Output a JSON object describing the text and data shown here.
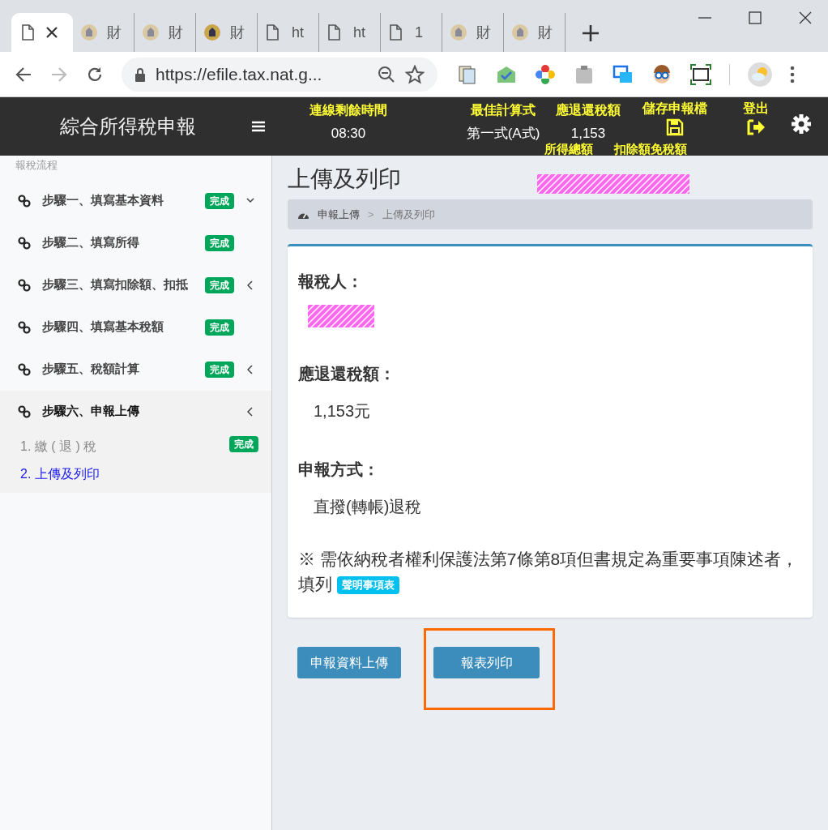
{
  "browser": {
    "tabs": [
      {
        "kind": "page",
        "selected": true
      },
      {
        "kind": "emblem",
        "label": "財",
        "selected": false
      },
      {
        "kind": "emblem",
        "label": "財",
        "selected": false
      },
      {
        "kind": "emblem-dark",
        "label": "財",
        "selected": false
      },
      {
        "kind": "page",
        "label": "ht",
        "selected": false
      },
      {
        "kind": "page",
        "label": "ht",
        "selected": false
      },
      {
        "kind": "page",
        "label": "1",
        "selected": false
      },
      {
        "kind": "emblem",
        "label": "財",
        "selected": false
      },
      {
        "kind": "emblem",
        "label": "財",
        "selected": false
      }
    ],
    "url": "https://efile.tax.nat.g..."
  },
  "header": {
    "title": "綜合所得稅申報",
    "stats": [
      {
        "label": "連線剩餘時間",
        "value": "08:30"
      },
      {
        "label": "最佳計算式",
        "value": "第一式(A式)"
      },
      {
        "label": "應退還稅額",
        "value": "1,153"
      }
    ],
    "actions": [
      {
        "label": "儲存申報檔",
        "kind": "save"
      },
      {
        "label": "登出",
        "kind": "logout"
      }
    ],
    "overflow_labels": [
      "所得總額",
      "扣除額免稅額"
    ]
  },
  "sidebar": {
    "heading": "報稅流程",
    "steps": [
      {
        "label": "步驟一、填寫基本資料",
        "badge": "完成",
        "kind": "down",
        "selected": false
      },
      {
        "label": "步驟二、填寫所得",
        "badge": "完成",
        "kind": "plain",
        "selected": false
      },
      {
        "label": "步驟三、填寫扣除額、扣抵",
        "badge": "完成",
        "kind": "left",
        "selected": false
      },
      {
        "label": "步驟四、填寫基本稅額",
        "badge": "完成",
        "kind": "plain",
        "selected": false
      },
      {
        "label": "步驟五、稅額計算",
        "badge": "完成",
        "kind": "left",
        "selected": false
      },
      {
        "label": "步驟六、申報上傳",
        "kind": "left",
        "selected": true,
        "children": [
          {
            "label": "1. 繳 ( 退 ) 稅",
            "badge": "完成",
            "selected": false
          },
          {
            "label": "2. 上傳及列印",
            "selected": true
          }
        ]
      }
    ]
  },
  "page": {
    "title": "上傳及列印",
    "breadcrumb": [
      "申報上傳",
      ">",
      "上傳及列印"
    ],
    "fields": [
      {
        "label": "報稅人：",
        "kind": "redacted"
      },
      {
        "label": "應退還稅額：",
        "kind": "text",
        "value": "1,153元"
      },
      {
        "label": "申報方式：",
        "kind": "text",
        "value": "直撥(轉帳)退稅"
      }
    ],
    "note": "※ 需依納稅者權利保護法第7條第8項但書規定為重要事項陳述者，填列",
    "note_tag": "聲明事項表",
    "buttons": [
      {
        "label": "申報資料上傳",
        "highlighted": false
      },
      {
        "label": "報表列印",
        "highlighted": true
      }
    ]
  }
}
